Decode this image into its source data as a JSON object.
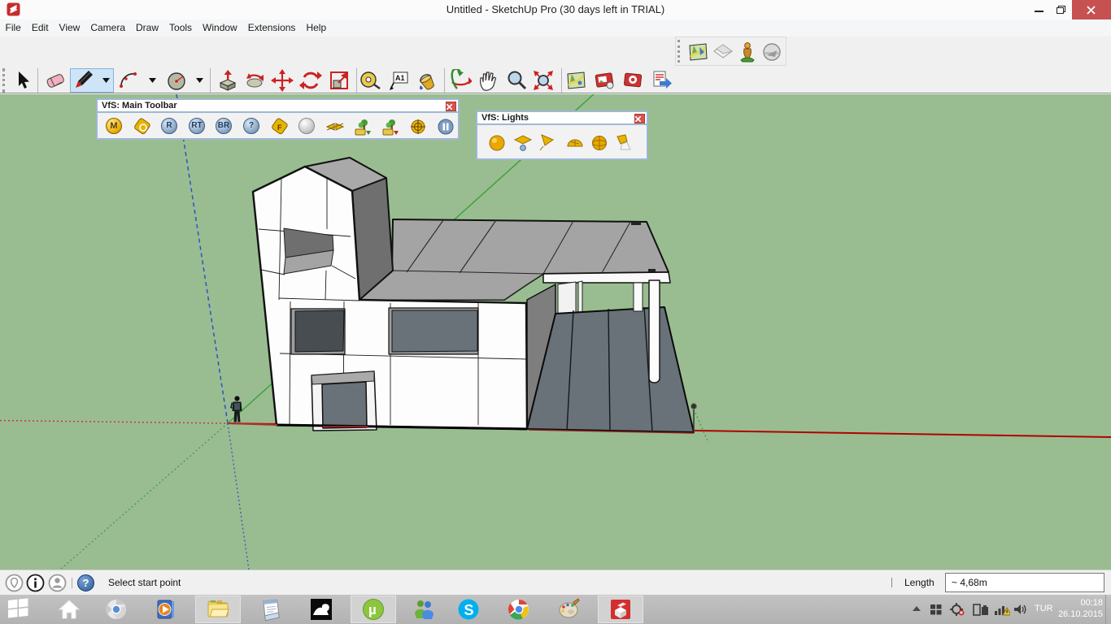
{
  "window": {
    "title": "Untitled - SketchUp Pro (30 days left in TRIAL)"
  },
  "menu": {
    "items": [
      "File",
      "Edit",
      "View",
      "Camera",
      "Draw",
      "Tools",
      "Window",
      "Extensions",
      "Help"
    ]
  },
  "main_toolbar": {
    "icons": [
      "select",
      "eraser",
      "line",
      "arc",
      "circle",
      "push-pull",
      "rotate",
      "move",
      "refresh",
      "scale",
      "tape-measure",
      "text",
      "paint-bucket",
      "orbit",
      "pan",
      "zoom",
      "zoom-extents",
      "add-location",
      "photo-texture",
      "match-photo",
      "export"
    ],
    "text_tool_glyph": "A1"
  },
  "location_toolbar": {
    "icons": [
      "add-location",
      "new-photo-match",
      "component-person",
      "geo-globe"
    ]
  },
  "vfs_main": {
    "title": "VfS: Main Toolbar",
    "icons": [
      "material-editor",
      "options-tag",
      "render",
      "render-rt",
      "batch-render",
      "help",
      "frame-buffer",
      "sphere",
      "infinite-plane",
      "import-proxy",
      "export-proxy",
      "sun-target",
      "pause"
    ],
    "badges": {
      "material": "M",
      "render": "R",
      "rt": "RT",
      "batch": "BR",
      "help": "?",
      "frame": "F"
    }
  },
  "vfs_lights": {
    "title": "VfS: Lights",
    "icons": [
      "omni-light",
      "rectangle-light",
      "spot-light",
      "dome-light",
      "sphere-light",
      "ies-light"
    ]
  },
  "statusbar": {
    "message": "Select start point",
    "length_label": "Length",
    "length_value": "~ 4,68m",
    "help_glyph": "?"
  },
  "taskbar": {
    "items": [
      "start",
      "home",
      "chrome-light",
      "media-player",
      "explorer",
      "notepad",
      "rhino",
      "utorrent",
      "messenger",
      "skype",
      "chrome",
      "paint-palette",
      "sketchup"
    ],
    "glyphs": {
      "skype": "S",
      "utorrent": "µ"
    },
    "tray": {
      "language": "TUR",
      "time": "00:18",
      "date": "26.10.2015"
    }
  },
  "colors": {
    "viewport_bg": "#99bd90",
    "axis_red": "#b20000",
    "axis_green": "#3da23d",
    "axis_blue": "#3050c8",
    "roof": "#a4a4a4",
    "glass": "#474d51",
    "drive": "#697278"
  }
}
